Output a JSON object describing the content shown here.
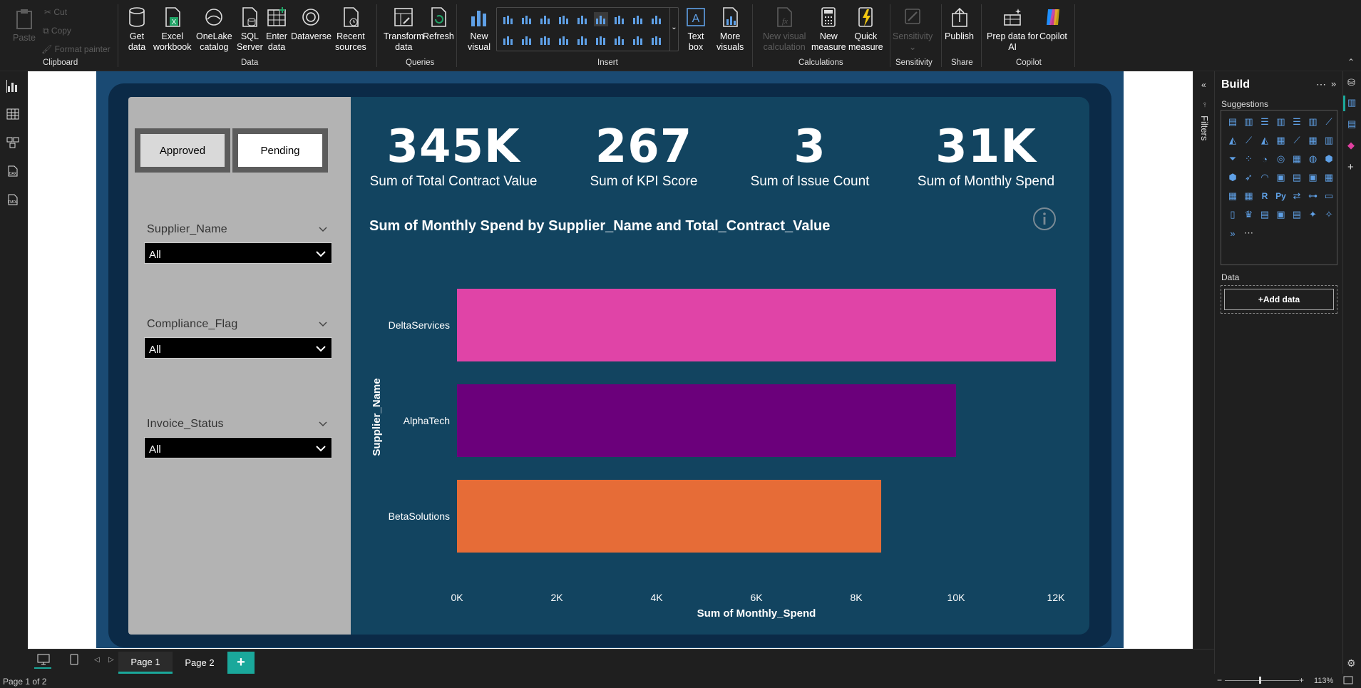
{
  "ribbon": {
    "clipboard": {
      "paste": "Paste",
      "cut": "Cut",
      "copy": "Copy",
      "format_painter": "Format painter",
      "group": "Clipboard"
    },
    "data": {
      "get_data": [
        "Get",
        "data"
      ],
      "excel": [
        "Excel",
        "workbook"
      ],
      "onelake": [
        "OneLake",
        "catalog"
      ],
      "sql": [
        "SQL",
        "Server"
      ],
      "enter": [
        "Enter",
        "data"
      ],
      "dataverse": "Dataverse",
      "recent": [
        "Recent",
        "sources"
      ],
      "group": "Data"
    },
    "queries": {
      "transform": [
        "Transform",
        "data"
      ],
      "refresh": "Refresh",
      "group": "Queries"
    },
    "insert": {
      "new_visual": [
        "New",
        "visual"
      ],
      "text_box": [
        "Text",
        "box"
      ],
      "more_visuals": [
        "More",
        "visuals"
      ],
      "group": "Insert"
    },
    "calculations": {
      "new_visual_calc": [
        "New visual",
        "calculation"
      ],
      "new_measure": [
        "New",
        "measure"
      ],
      "quick_measure": [
        "Quick",
        "measure"
      ],
      "group": "Calculations"
    },
    "sensitivity": {
      "label": "Sensitivity",
      "group": "Sensitivity"
    },
    "share": {
      "publish": "Publish",
      "group": "Share"
    },
    "copilot": {
      "prep": [
        "Prep data for",
        "AI"
      ],
      "copilot": "Copilot",
      "group": "Copilot"
    }
  },
  "slicer": {
    "tiles": [
      "Approved",
      "Pending"
    ],
    "filters": [
      {
        "label": "Supplier_Name",
        "value": "All"
      },
      {
        "label": "Compliance_Flag",
        "value": "All"
      },
      {
        "label": "Invoice_Status",
        "value": "All"
      }
    ]
  },
  "kpis": [
    {
      "value": "345K",
      "label": "Sum of Total Contract Value"
    },
    {
      "value": "267",
      "label": "Sum of KPI Score"
    },
    {
      "value": "3",
      "label": "Sum of Issue Count"
    },
    {
      "value": "31K",
      "label": "Sum of Monthly Spend"
    }
  ],
  "chart_data": {
    "type": "bar",
    "orientation": "horizontal",
    "title": "Sum of Monthly Spend by Supplier_Name and Total_Contract_Value",
    "xlabel": "Sum of Monthly_Spend",
    "ylabel": "Supplier_Name",
    "categories": [
      "DeltaServices",
      "AlphaTech",
      "BetaSolutions"
    ],
    "values": [
      12000,
      10000,
      8500
    ],
    "colors": [
      "#e044a7",
      "#6b007b",
      "#e66c37"
    ],
    "xlim": [
      0,
      12000
    ],
    "xticks": [
      "0K",
      "2K",
      "4K",
      "6K",
      "8K",
      "10K",
      "12K"
    ],
    "grid": false
  },
  "pages": {
    "tabs": [
      "Page 1",
      "Page 2"
    ],
    "add": "+",
    "status": "Page 1 of 2",
    "zoom": "113%"
  },
  "build_panel": {
    "title": "Build",
    "suggestions": "Suggestions",
    "data_label": "Data",
    "add_data": "+Add data",
    "filters": "Filters"
  },
  "colors": {
    "accent": "#1aa89b",
    "report_bg": "#1a4a73",
    "panel_bg": "#124460",
    "slicer_bg": "#b3b3b3"
  }
}
